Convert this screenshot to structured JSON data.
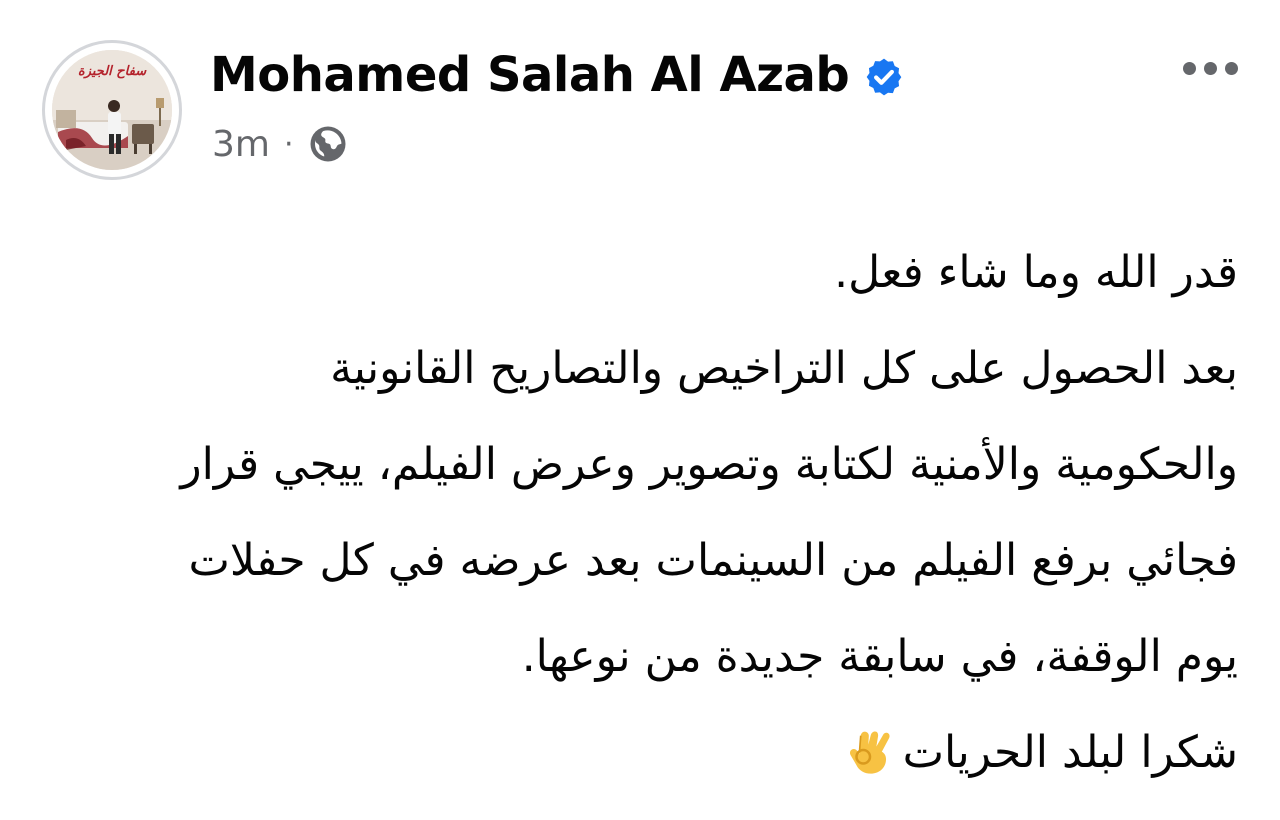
{
  "post": {
    "author": {
      "name": "Mohamed Salah Al Azab",
      "verified": true,
      "avatar_caption": "سفاح الجيزة"
    },
    "timestamp": "3m",
    "separator": "·",
    "audience_icon": "globe-icon",
    "more_icon": "more-horizontal-icon",
    "text_lines": [
      "قدر الله وما شاء فعل.",
      "بعد الحصول على كل التراخيص والتصاريح القانونية",
      "والحكومية والأمنية لكتابة وتصوير وعرض الفيلم، ييجي قرار",
      "فجائي برفع الفيلم من السينمات بعد عرضه في كل حفلات",
      "يوم الوقفة، في سابقة جديدة من نوعها.",
      "شكرا لبلد الحريات"
    ],
    "closing_emoji": "ok-hand-emoji",
    "colors": {
      "name": "#050505",
      "meta": "#65676b",
      "verified_badge": "#1877f2",
      "avatar_ring": "#d4d6da"
    }
  }
}
